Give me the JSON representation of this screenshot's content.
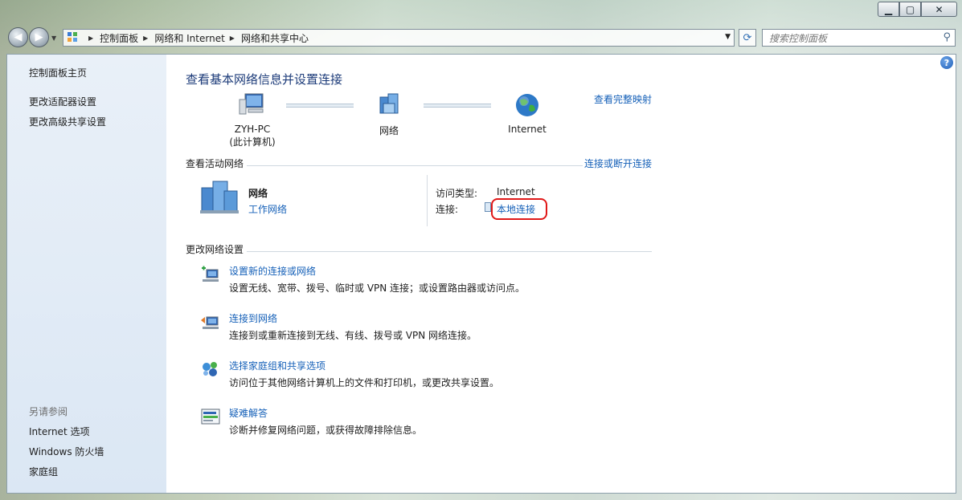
{
  "window": {
    "min_glyph": "▁",
    "max_glyph": "▢",
    "close_glyph": "✕"
  },
  "nav": {
    "back_glyph": "◀",
    "forward_glyph": "▶",
    "breadcrumb": [
      "控制面板",
      "网络和 Internet",
      "网络和共享中心"
    ],
    "search_placeholder": "搜索控制面板",
    "icons": [
      "back-arrow-icon",
      "forward-arrow-icon",
      "control-panel-icon",
      "refresh-icon",
      "search-icon"
    ]
  },
  "sidebar": {
    "home": "控制面板主页",
    "links": [
      "更改适配器设置",
      "更改高级共享设置"
    ],
    "see_also_heading": "另请参阅",
    "see_also": [
      "Internet 选项",
      "Windows 防火墙",
      "家庭组"
    ]
  },
  "main": {
    "title": "查看基本网络信息并设置连接",
    "full_map": "查看完整映射",
    "map": {
      "computer_name": "ZYH-PC",
      "computer_sub": "(此计算机)",
      "network": "网络",
      "internet": "Internet"
    },
    "active": {
      "heading": "查看活动网络",
      "connect_link": "连接或断开连接",
      "network_name": "网络",
      "network_type": "工作网络",
      "access_label": "访问类型:",
      "access_value": "Internet",
      "conn_label": "连接:",
      "conn_value": "本地连接"
    },
    "change": {
      "heading": "更改网络设置",
      "tasks": [
        {
          "link": "设置新的连接或网络",
          "desc": "设置无线、宽带、拨号、临时或 VPN 连接；或设置路由器或访问点。",
          "icon": "new-connection-icon"
        },
        {
          "link": "连接到网络",
          "desc": "连接到或重新连接到无线、有线、拨号或 VPN 网络连接。",
          "icon": "connect-network-icon"
        },
        {
          "link": "选择家庭组和共享选项",
          "desc": "访问位于其他网络计算机上的文件和打印机，或更改共享设置。",
          "icon": "homegroup-icon"
        },
        {
          "link": "疑难解答",
          "desc": "诊断并修复网络问题，或获得故障排除信息。",
          "icon": "troubleshoot-icon"
        }
      ]
    }
  },
  "help_glyph": "?",
  "colors": {
    "link": "#1560b8",
    "title": "#1c3b79",
    "highlight": "#e01818"
  }
}
